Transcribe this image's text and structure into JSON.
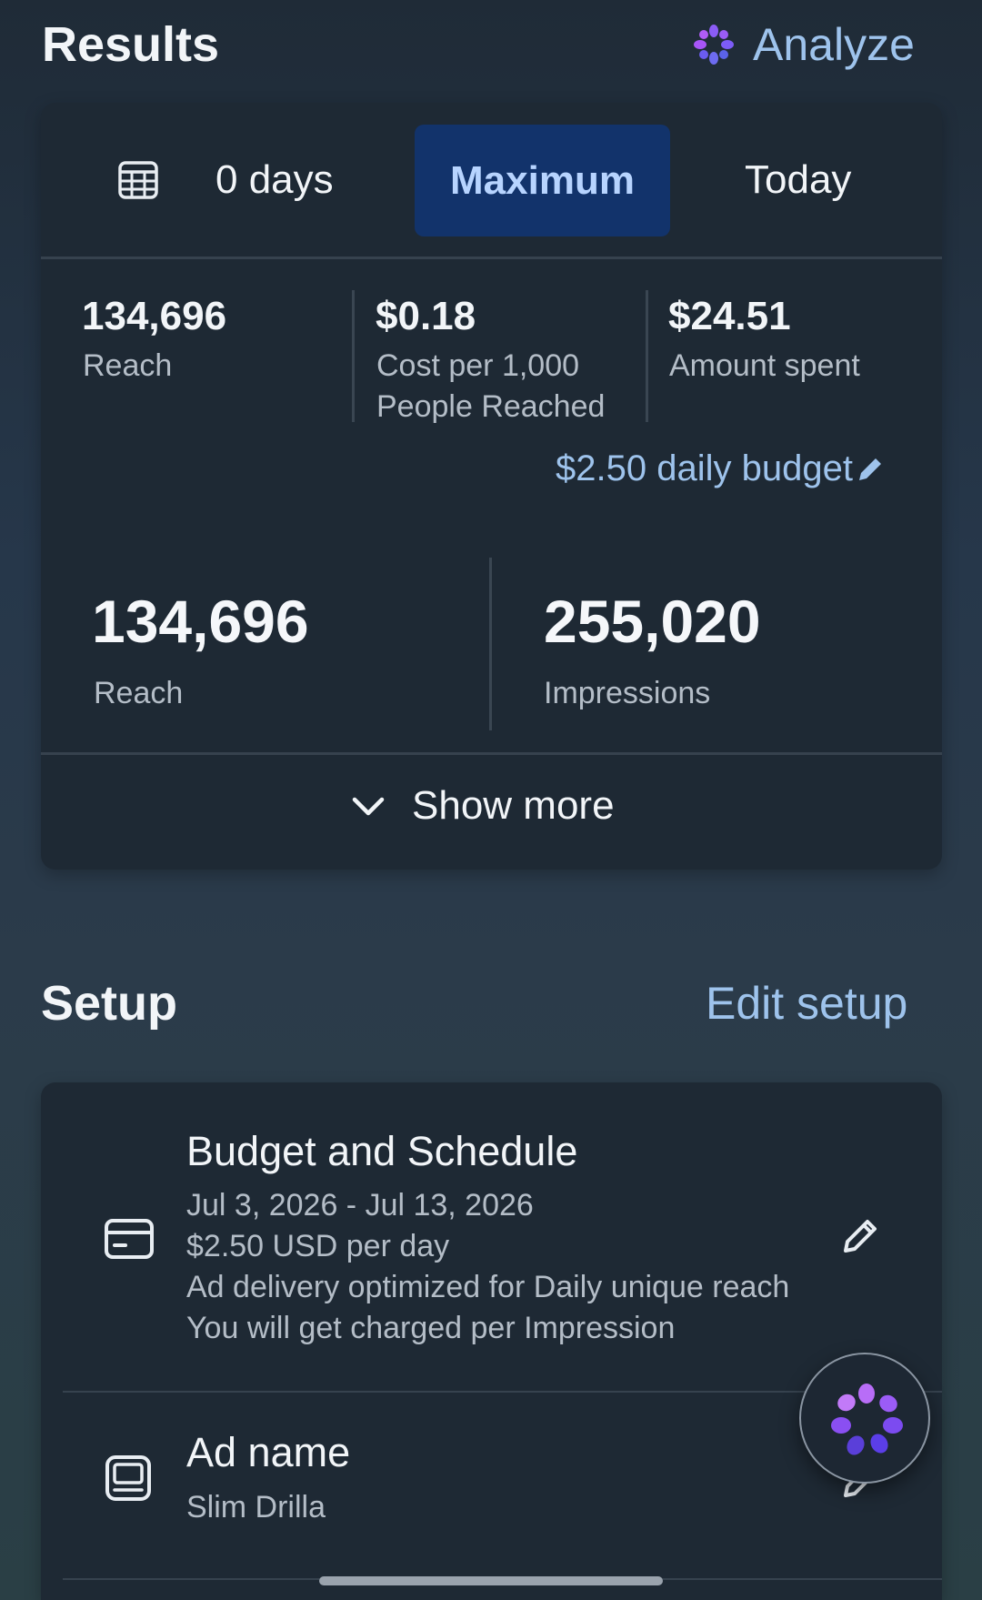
{
  "results": {
    "title": "Results",
    "analyze_label": "Analyze"
  },
  "date_range": {
    "days_label": "0 days",
    "active_tab": "Maximum",
    "today_tab": "Today"
  },
  "summary": {
    "reach_value": "134,696",
    "reach_label": "Reach",
    "cpm_value": "$0.18",
    "cpm_label_line1": "Cost per 1,000",
    "cpm_label_line2": "People Reached",
    "spent_value": "$24.51",
    "spent_label": "Amount spent",
    "daily_budget_link": "$2.50 daily budget"
  },
  "metrics": {
    "reach_value": "134,696",
    "reach_label": "Reach",
    "impressions_value": "255,020",
    "impressions_label": "Impressions"
  },
  "show_more_label": "Show more",
  "setup": {
    "title": "Setup",
    "edit_label": "Edit setup",
    "budget": {
      "title": "Budget and Schedule",
      "dates": "Jul 3, 2026 - Jul 13, 2026",
      "amount": "$2.50 USD per day",
      "delivery": "Ad delivery optimized for Daily unique reach",
      "charge": "You will get charged per Impression"
    },
    "ad_name": {
      "title": "Ad name",
      "value": "Slim Drilla"
    }
  },
  "colors": {
    "accent_link": "#9ec3ec",
    "active_tab_bg": "#12336b",
    "card_bg": "#1e2934",
    "analyze_icon": "#8b5cf6"
  },
  "icons": {
    "analyze": "sparkle-flower-icon",
    "calendar": "calendar-icon",
    "edit": "pencil-icon",
    "chevron": "chevron-down-icon",
    "card": "credit-card-icon",
    "ad": "ad-preview-icon",
    "fab": "ai-assistant-icon"
  }
}
